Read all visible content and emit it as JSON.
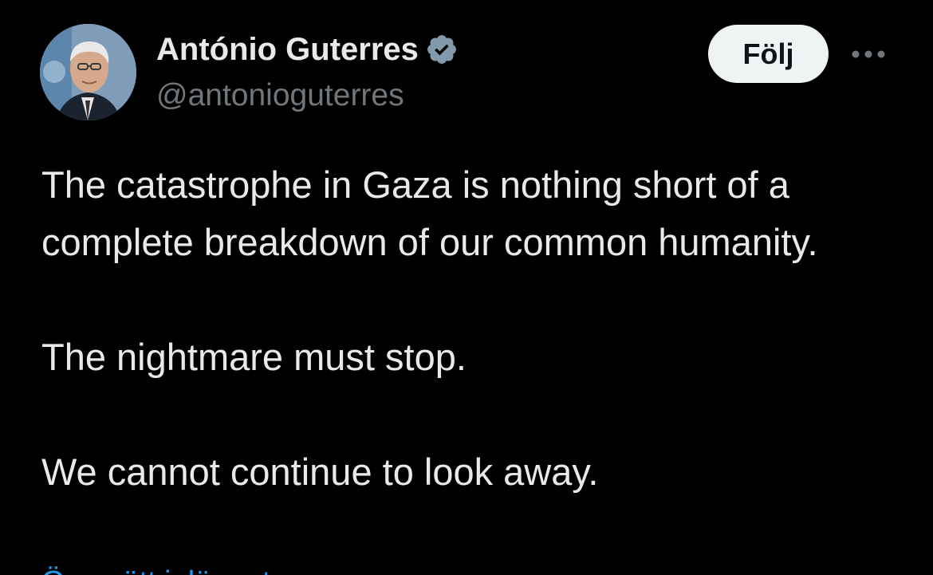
{
  "author": {
    "display_name": "António Guterres",
    "handle": "@antonioguterres",
    "verified": true,
    "avatar_icon": "profile-photo"
  },
  "actions": {
    "follow_label": "Följ",
    "more_icon": "more-horizontal-icon"
  },
  "tweet": {
    "paragraphs": [
      "The catastrophe in Gaza is nothing short of a complete breakdown of our common humanity.",
      "The nightmare must stop.",
      "We cannot continue to look away."
    ],
    "translate_label": "Översätt inlägget"
  },
  "colors": {
    "background": "#000000",
    "text_primary": "#e7e9ea",
    "text_secondary": "#71767b",
    "verified_badge": "#829aab",
    "link": "#1d9bf0",
    "follow_button_bg": "#eff3f4",
    "follow_button_text": "#0f1419"
  }
}
